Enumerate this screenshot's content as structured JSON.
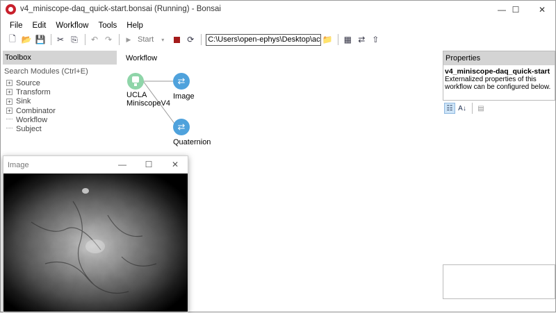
{
  "window": {
    "title": "v4_miniscope-daq_quick-start.bonsai (Running) - Bonsai",
    "minimize": "—",
    "maximize": "☐",
    "close": "✕"
  },
  "menu": [
    "File",
    "Edit",
    "Workflow",
    "Tools",
    "Help"
  ],
  "toolbar": {
    "start_label": "Start",
    "path_value": "C:\\Users\\open-ephys\\Desktop\\active"
  },
  "toolbox": {
    "header": "Toolbox",
    "search_label": "Search Modules (Ctrl+E)",
    "categories": [
      "Source",
      "Transform",
      "Sink",
      "Combinator"
    ],
    "leaves": [
      "Workflow",
      "Subject"
    ]
  },
  "workflow": {
    "label": "Workflow",
    "nodes": {
      "source_line1": "UCLA",
      "source_line2": "MiniscopeV4",
      "image": "Image",
      "quaternion": "Quaternion"
    }
  },
  "properties": {
    "header": "Properties",
    "name": "v4_miniscope-daq_quick-start",
    "description": "Externalized properties of this workflow can be configured below."
  },
  "image_window": {
    "title": "Image",
    "minimize": "—",
    "maximize": "☐",
    "close": "✕"
  },
  "colors": {
    "source_node": "#8fd5a9",
    "selector_node": "#4fa2dc",
    "stop_button": "#a41b1b",
    "app_icon": "#c8202c"
  }
}
